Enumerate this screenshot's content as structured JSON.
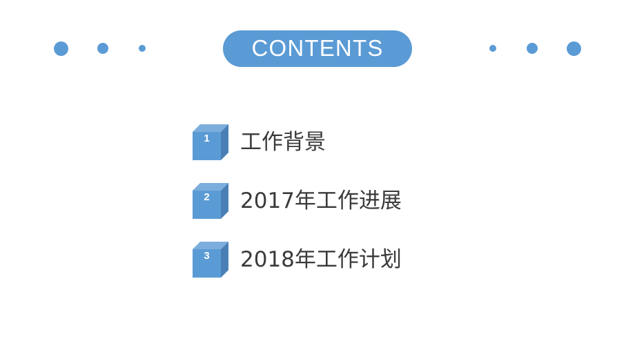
{
  "slide": {
    "background_color": "#ffffff",
    "accent_color": "#5B9BD5",
    "text_color": "#3a3a3a"
  },
  "header": {
    "title": "CONTENTS",
    "left_dots": [
      {
        "name": "decor-dot-large",
        "size": "s-lg"
      },
      {
        "name": "decor-dot-medium",
        "size": "s-md"
      },
      {
        "name": "decor-dot-small",
        "size": "s-sm"
      }
    ],
    "right_dots": [
      {
        "name": "decor-dot-small",
        "size": "s-sm"
      },
      {
        "name": "decor-dot-medium",
        "size": "s-md"
      },
      {
        "name": "decor-dot-large",
        "size": "s-lg"
      }
    ]
  },
  "contents": {
    "items": [
      {
        "number": "1",
        "label": "工作背景",
        "icon": "numbered-cube-icon"
      },
      {
        "number": "2",
        "label": "2017年工作进展",
        "icon": "numbered-cube-icon"
      },
      {
        "number": "3",
        "label": "2018年工作计划",
        "icon": "numbered-cube-icon"
      }
    ]
  },
  "cube_colors": {
    "front": "#5B9BD5",
    "top": "#7BAEDC",
    "side": "#4A7FB5",
    "shadow": "#e8e8e8"
  }
}
